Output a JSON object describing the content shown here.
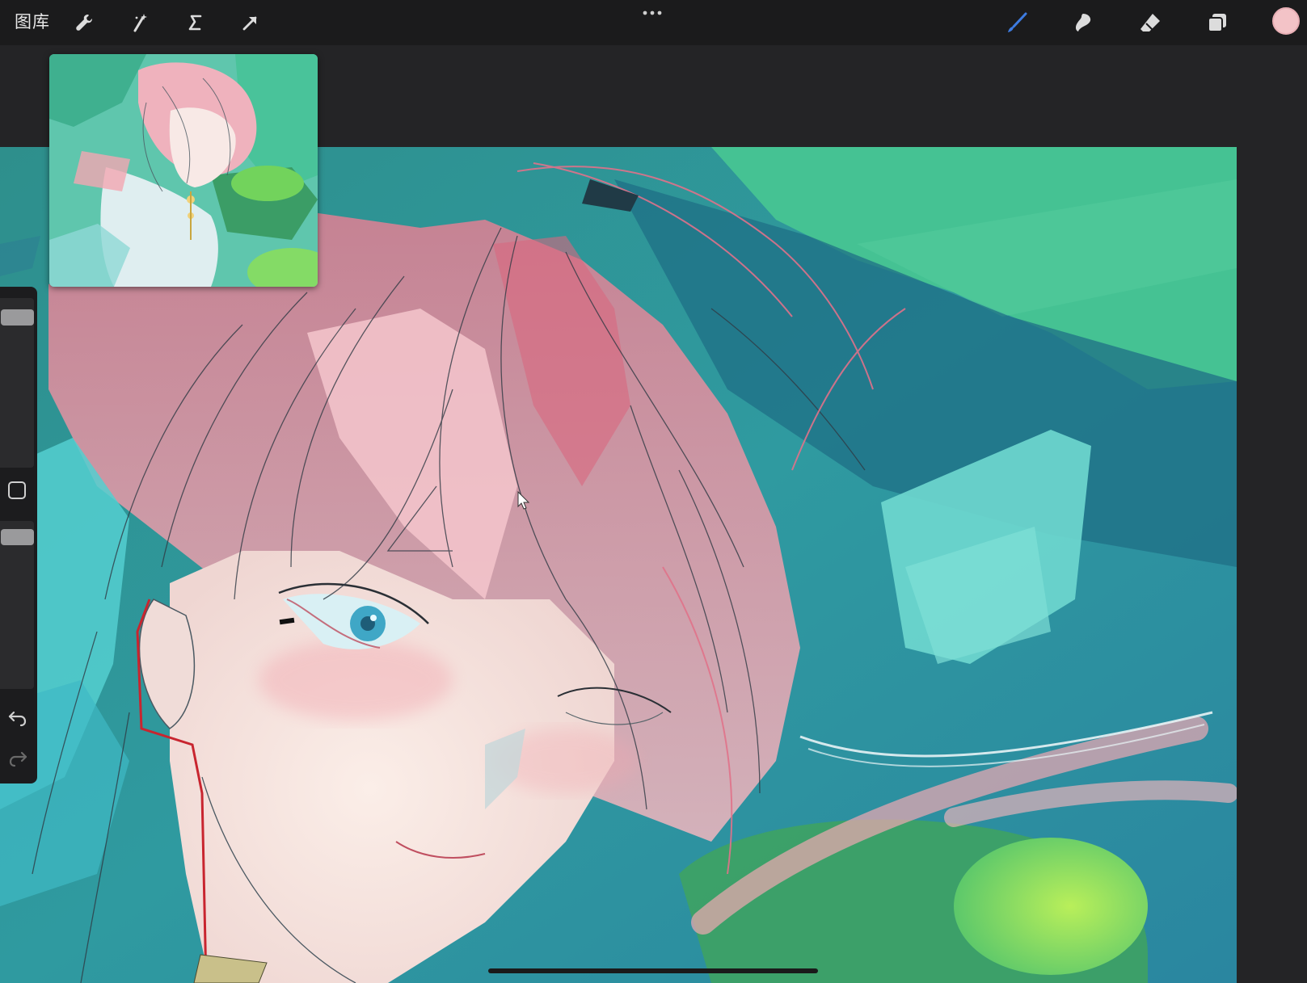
{
  "toolbar": {
    "gallery_label": "图库",
    "left_tools": [
      "wrench-icon",
      "magic-wand-icon",
      "selection-icon",
      "transform-arrow-icon"
    ],
    "right_tools": [
      "brush-icon",
      "smudge-icon",
      "eraser-icon",
      "layers-icon"
    ],
    "current_color": "#f3c3c7",
    "brush_accent": "#3d7be0"
  },
  "sidebar": {
    "brush_size_level": 0.08,
    "opacity_level": 0.05,
    "undo_icon": "undo-icon",
    "redo_icon": "redo-icon"
  },
  "canvas": {
    "background_color": "#3fb8a0",
    "hair_color": "#e9a3ac",
    "skin_color": "#f6e4dd",
    "eye_color": "#3fa7c6"
  }
}
